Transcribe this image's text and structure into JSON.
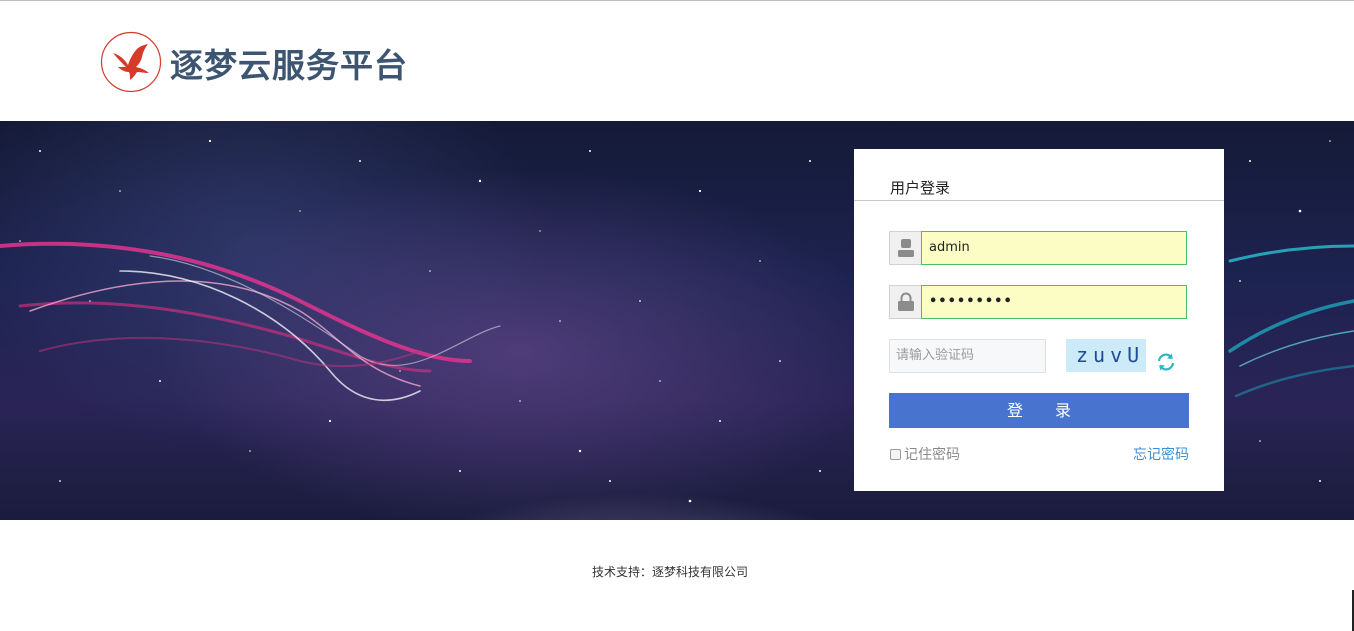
{
  "header": {
    "brand_name": "逐梦云服务平台",
    "logo_icon": "red-bird-logo-icon",
    "brand_color": "#3d5570",
    "logo_color": "#d63b2a"
  },
  "login": {
    "title": "用户登录",
    "username_value": "admin",
    "password_value": "•••••••••",
    "captcha_placeholder": "请输入验证码",
    "captcha_text": "zuvU",
    "login_button_label": "登　　录",
    "remember_label": "记住密码",
    "forgot_label": "忘记密码",
    "icons": {
      "username": "user-icon",
      "password": "lock-icon",
      "refresh": "refresh-icon"
    },
    "colors": {
      "button": "#4874cf",
      "field_fill": "#fbfdc4",
      "field_border": "#4bbf66",
      "captcha_bg": "#cdeaf9",
      "link": "#3b8ed6",
      "refresh": "#2db7c4"
    }
  },
  "footer": {
    "text": "技术支持：逐梦科技有限公司"
  }
}
